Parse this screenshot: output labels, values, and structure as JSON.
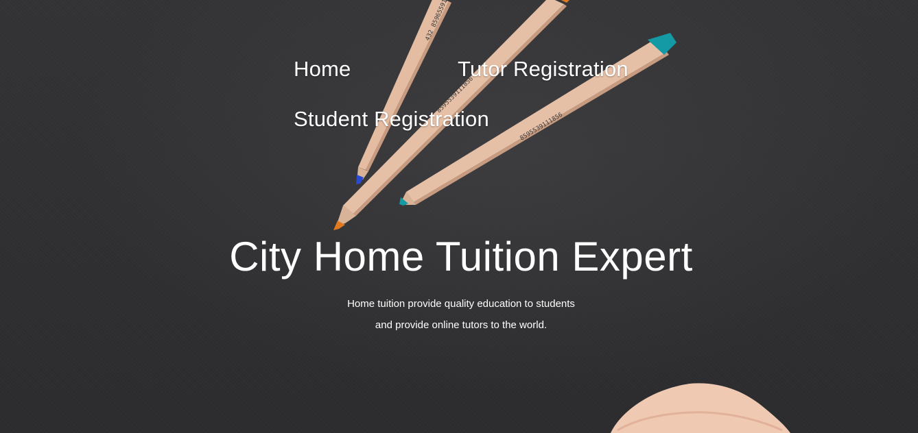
{
  "nav": {
    "home_label": "Home",
    "tutor_label": "Tutor Registration",
    "student_label": "Student Registration"
  },
  "hero": {
    "title": "City Home Tuition Expert",
    "subtitle_line1": "Home tuition provide quality education to students",
    "subtitle_line2": "and provide online tutors to the world."
  },
  "colors": {
    "background": "#2f2f31",
    "text": "#ffffff",
    "pencil_wood": "#e2b89c",
    "pencil_blue_tip": "#2a4bd0",
    "pencil_orange_tip": "#e07a1e",
    "pencil_teal_tip": "#149aa5"
  },
  "images": {
    "background": "pencils-on-dark-paper",
    "hand": "finger-bottom-right"
  }
}
